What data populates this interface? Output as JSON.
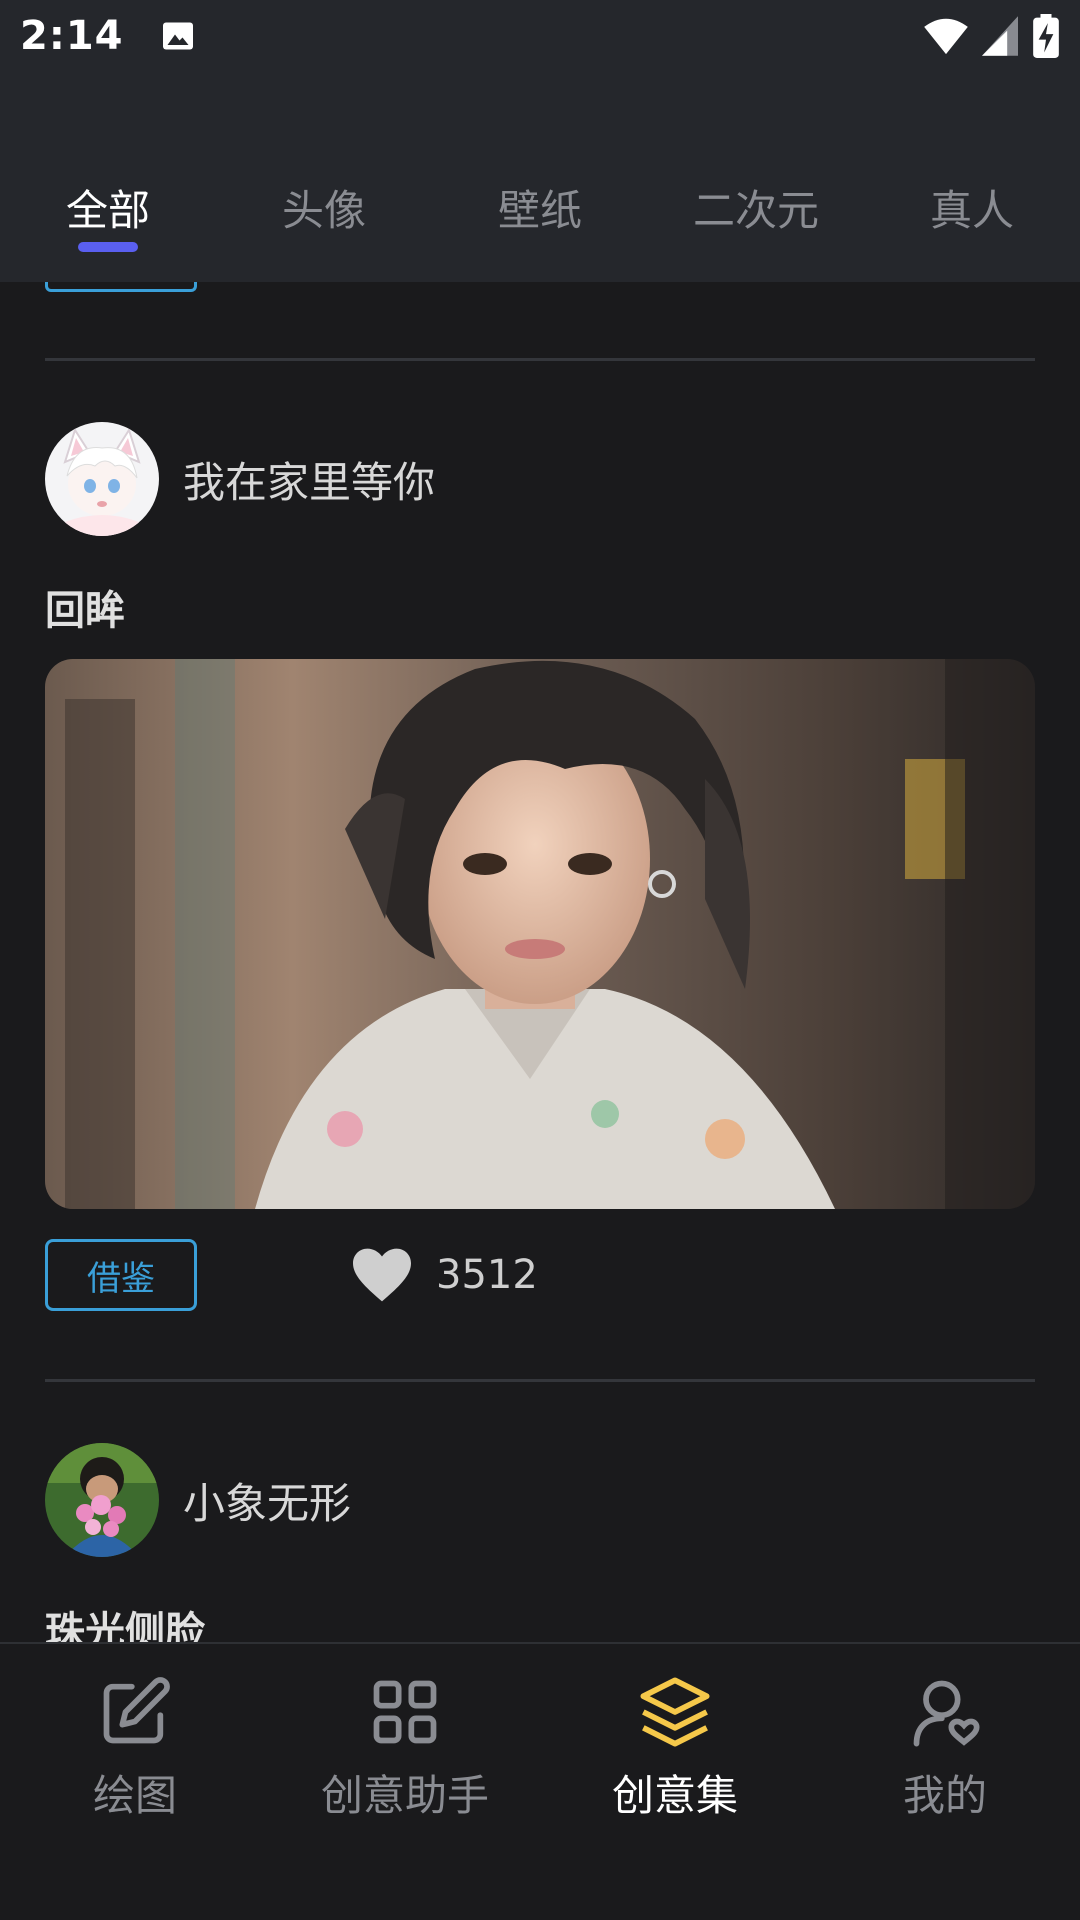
{
  "status_bar": {
    "time": "2:14"
  },
  "tabs": [
    {
      "label": "全部",
      "active": true
    },
    {
      "label": "头像",
      "active": false
    },
    {
      "label": "壁纸",
      "active": false
    },
    {
      "label": "二次元",
      "active": false
    },
    {
      "label": "真人",
      "active": false
    }
  ],
  "posts": [
    {
      "author": "我在家里等你",
      "title": "回眸",
      "reference_label": "借鉴",
      "likes": "3512"
    },
    {
      "author": "小象无形",
      "title": "珠光侧脸"
    }
  ],
  "bottom_nav": [
    {
      "label": "绘图",
      "icon": "edit-icon",
      "active": false
    },
    {
      "label": "创意助手",
      "icon": "grid-icon",
      "active": false
    },
    {
      "label": "创意集",
      "icon": "layers-icon",
      "active": true
    },
    {
      "label": "我的",
      "icon": "user-heart-icon",
      "active": false
    }
  ],
  "colors": {
    "accent": "#5a5ff0",
    "reference_border": "#3a9fd8",
    "active_nav_icon": "#f5c84a",
    "header_bg": "#25272c",
    "page_bg": "#1a1a1c"
  }
}
